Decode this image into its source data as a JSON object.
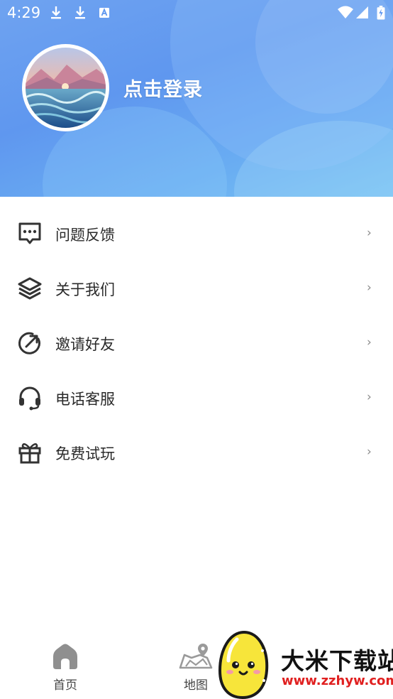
{
  "status_bar": {
    "time": "4:29",
    "icons": [
      "download-icon",
      "download-icon",
      "text-recognition-icon",
      "wifi-icon",
      "cell-signal-icon",
      "battery-charging-icon"
    ]
  },
  "profile": {
    "avatar": "landscape-avatar",
    "login_label": "点击登录"
  },
  "menu": {
    "items": [
      {
        "label": "问题反馈",
        "icon": "chat-feedback-icon"
      },
      {
        "label": "关于我们",
        "icon": "layers-icon"
      },
      {
        "label": "邀请好友",
        "icon": "share-arrow-icon"
      },
      {
        "label": "电话客服",
        "icon": "headset-icon"
      },
      {
        "label": "免费试玩",
        "icon": "gift-icon"
      }
    ],
    "chevron": "›"
  },
  "bottom_nav": {
    "items": [
      {
        "label": "首页",
        "icon": "home-icon"
      },
      {
        "label": "地图",
        "icon": "map-icon"
      }
    ]
  },
  "watermark": {
    "title": "大米下载站",
    "url": "www.zzhyw.com"
  },
  "colors": {
    "header_gradient_start": "#6fa3f0",
    "header_gradient_end": "#78c3f4",
    "text": "#2a2a2a",
    "icon": "#333333",
    "watermark_url": "#e02020"
  }
}
